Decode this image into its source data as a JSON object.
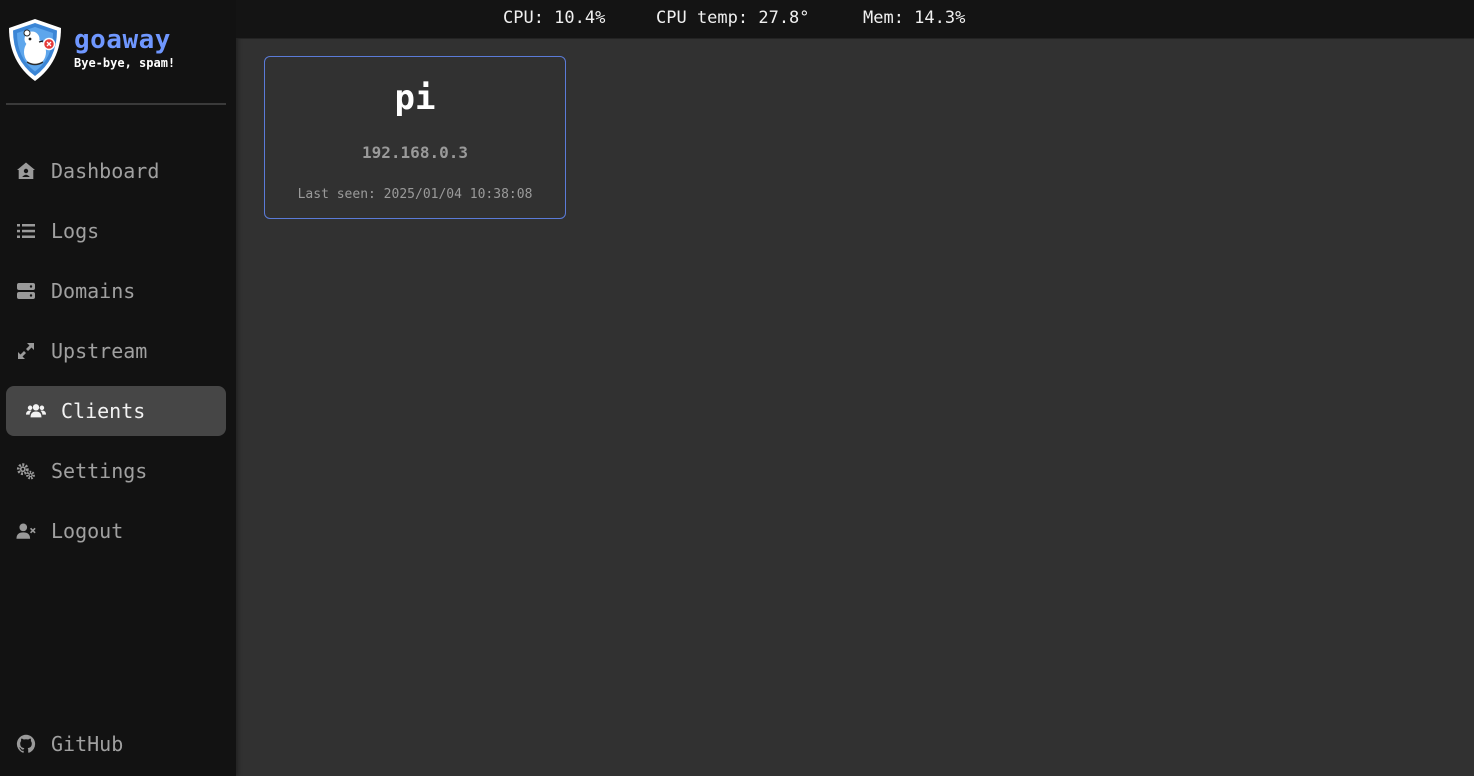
{
  "brand": {
    "name": "goaway",
    "tagline": "Bye-bye, spam!",
    "name_color": "#6f97ff",
    "logo_icon": "shield-mascot-logo"
  },
  "sidebar": {
    "items": [
      {
        "label": "Dashboard",
        "icon": "house-user-icon"
      },
      {
        "label": "Logs",
        "icon": "list-icon"
      },
      {
        "label": "Domains",
        "icon": "server-icon"
      },
      {
        "label": "Upstream",
        "icon": "expand-arrows-icon"
      },
      {
        "label": "Clients",
        "icon": "users-icon",
        "active": true
      },
      {
        "label": "Settings",
        "icon": "gears-icon"
      },
      {
        "label": "Logout",
        "icon": "user-xmark-icon"
      }
    ],
    "footer": {
      "label": "GitHub",
      "icon": "github-icon"
    }
  },
  "stats": {
    "cpu": "CPU: 10.4%",
    "cpu_temp": "CPU temp: 27.8°",
    "mem": "Mem: 14.3%"
  },
  "clients": [
    {
      "name": "pi",
      "ip": "192.168.0.3",
      "last_seen": "Last seen: 2025/01/04 10:38:08"
    }
  ],
  "colors": {
    "sidebar_bg": "#121212",
    "main_bg": "#313131",
    "active_item_bg": "#464646",
    "card_border": "#5b7bd8"
  }
}
